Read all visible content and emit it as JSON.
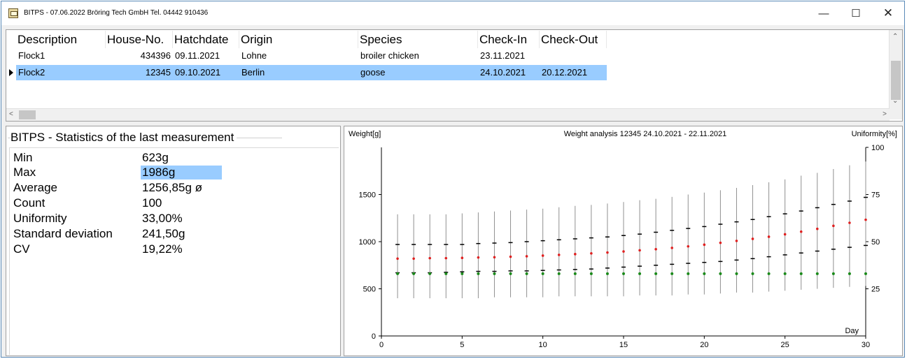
{
  "window": {
    "title": "BITPS - 07.06.2022 Bröring Tech GmbH  Tel. 04442 910436",
    "minimize_glyph": "—",
    "maximize_glyph": "☐",
    "close_glyph": "✕"
  },
  "grid": {
    "columns": [
      "Description",
      "House-No.",
      "Hatchdate",
      "Origin",
      "Species",
      "Check-In",
      "Check-Out"
    ],
    "rows": [
      {
        "description": "Flock1",
        "house_no": "434396",
        "hatchdate": "09.11.2021",
        "origin": "Lohne",
        "species": "broiler chicken",
        "check_in": "23.11.2021",
        "check_out": "",
        "selected": false
      },
      {
        "description": "Flock2",
        "house_no": "12345",
        "hatchdate": "09.10.2021",
        "origin": "Berlin",
        "species": "goose",
        "check_in": "24.10.2021",
        "check_out": "20.12.2021",
        "selected": true
      }
    ],
    "scroll_up_glyph": "⌃",
    "scroll_down_glyph": "⌄",
    "scroll_left_glyph": "<",
    "scroll_right_glyph": ">"
  },
  "stats": {
    "title": "BITPS - Statistics of the last measurement",
    "items": [
      {
        "label": "Min",
        "value": "623g"
      },
      {
        "label": "Max",
        "value": "1986g"
      },
      {
        "label": "Average",
        "value": "1256,85g ø"
      },
      {
        "label": "Count",
        "value": "100"
      },
      {
        "label": "Uniformity",
        "value": "33,00%"
      },
      {
        "label": "Standard deviation",
        "value": "241,50g"
      },
      {
        "label": "CV",
        "value": "19,22%"
      }
    ]
  },
  "colors": {
    "selection": "#99ccff",
    "average_marker": "#e02020",
    "uniformity_marker": "#1a8a1a",
    "range_line": "#909090"
  },
  "chart_data": {
    "type": "scatter",
    "title": "Weight analysis 12345 24.10.2021 - 22.11.2021",
    "ylabel": "Weight[g]",
    "y2label": "Uniformity[%]",
    "xlabel": "Day",
    "xlim": [
      0,
      30
    ],
    "ylim": [
      0,
      2000
    ],
    "y2lim": [
      0,
      100
    ],
    "x_ticks": [
      0,
      5,
      10,
      15,
      20,
      25,
      30
    ],
    "y_ticks": [
      0,
      500,
      1000,
      1500
    ],
    "y2_ticks": [
      25,
      50,
      75,
      100
    ],
    "x": [
      1,
      2,
      3,
      4,
      5,
      6,
      7,
      8,
      9,
      10,
      11,
      12,
      13,
      14,
      15,
      16,
      17,
      18,
      19,
      20,
      21,
      22,
      23,
      24,
      25,
      26,
      27,
      28,
      29,
      30
    ],
    "series": [
      {
        "kind": "average",
        "values": [
          820,
          820,
          825,
          825,
          828,
          832,
          835,
          840,
          845,
          852,
          860,
          868,
          876,
          885,
          896,
          908,
          920,
          934,
          950,
          968,
          988,
          1008,
          1030,
          1052,
          1078,
          1106,
          1136,
          1168,
          1200,
          1232
        ]
      },
      {
        "kind": "uniformity",
        "values": [
          33,
          33,
          33,
          33,
          33,
          33,
          33,
          33,
          33,
          33,
          33,
          33,
          33,
          33,
          33,
          33,
          33,
          33,
          33,
          33,
          33,
          33,
          33,
          33,
          33,
          33,
          33,
          33,
          33,
          33
        ]
      },
      {
        "kind": "max",
        "values": [
          1290,
          1290,
          1290,
          1290,
          1300,
          1310,
          1320,
          1330,
          1340,
          1350,
          1365,
          1380,
          1390,
          1405,
          1420,
          1440,
          1455,
          1475,
          1500,
          1520,
          1545,
          1570,
          1600,
          1630,
          1660,
          1700,
          1730,
          1770,
          1810,
          1850
        ]
      },
      {
        "kind": "min",
        "values": [
          400,
          400,
          400,
          400,
          400,
          400,
          410,
          410,
          410,
          410,
          420,
          420,
          420,
          420,
          420,
          430,
          430,
          430,
          440,
          440,
          450,
          460,
          460,
          470,
          480,
          490,
          500,
          510,
          520,
          530
        ]
      },
      {
        "kind": "upper_sd",
        "values": [
          970,
          970,
          970,
          970,
          970,
          980,
          985,
          990,
          1000,
          1010,
          1020,
          1030,
          1040,
          1050,
          1065,
          1080,
          1100,
          1120,
          1140,
          1160,
          1185,
          1210,
          1235,
          1265,
          1295,
          1325,
          1360,
          1395,
          1430,
          1470
        ]
      },
      {
        "kind": "lower_sd",
        "values": [
          670,
          670,
          670,
          675,
          680,
          685,
          685,
          690,
          690,
          695,
          700,
          705,
          710,
          720,
          730,
          740,
          750,
          760,
          770,
          780,
          790,
          805,
          820,
          840,
          860,
          880,
          900,
          920,
          940,
          960
        ]
      }
    ]
  }
}
